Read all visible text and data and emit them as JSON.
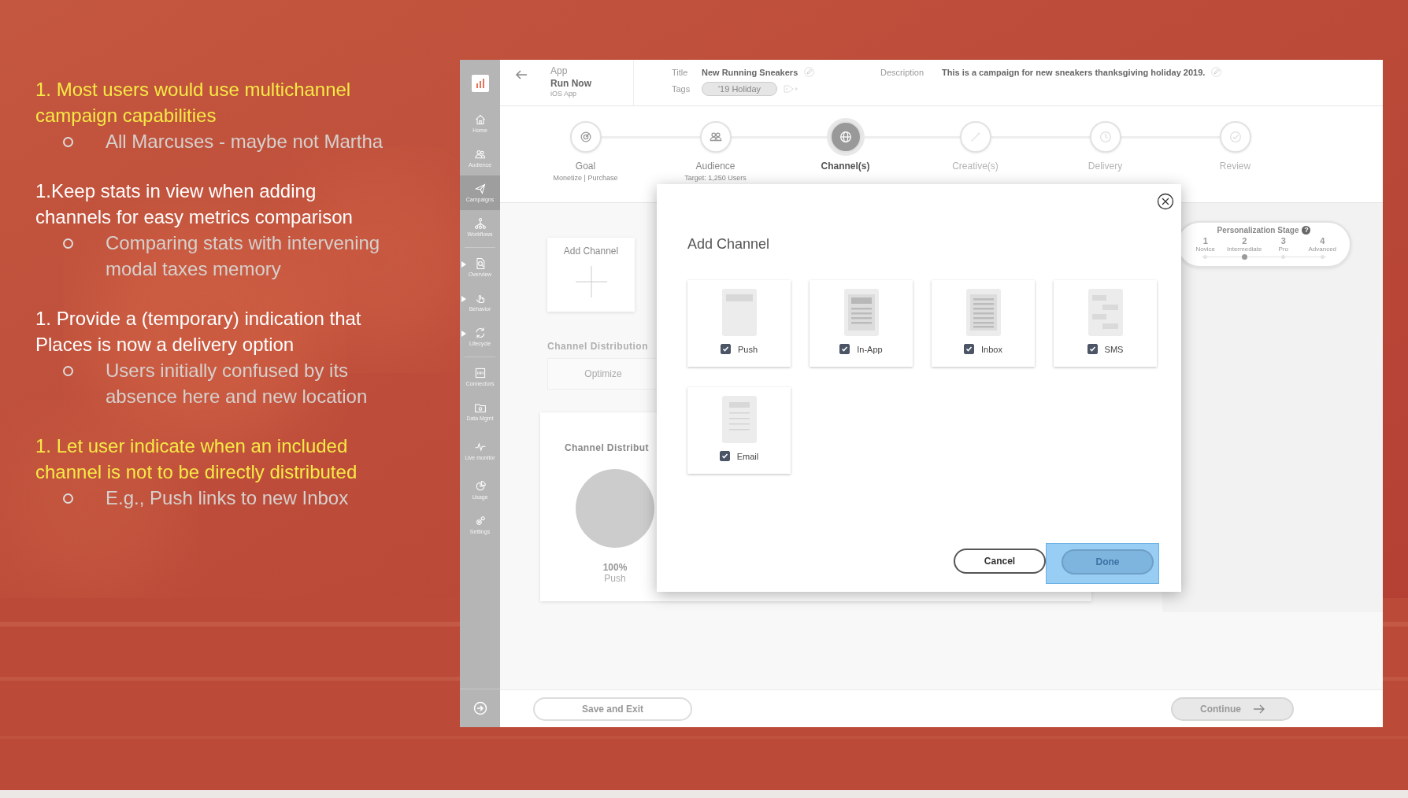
{
  "notes": [
    {
      "heading": "1. Most users would use multichannel campaign capabilities",
      "highlighted": true,
      "subpoints": [
        "All Marcuses - maybe not Martha"
      ]
    },
    {
      "heading": "1.Keep stats in view when adding channels for easy metrics comparison",
      "highlighted": false,
      "subpoints": [
        "Comparing stats with intervening modal taxes memory"
      ]
    },
    {
      "heading": "1. Provide a (temporary) indication that Places is now a delivery option",
      "highlighted": false,
      "subpoints": [
        "Users initially confused by its absence here and new location"
      ]
    },
    {
      "heading": "1. Let user indicate when an included channel is not to be directly distributed",
      "highlighted": true,
      "subpoints": [
        "E.g., Push links to new Inbox"
      ]
    }
  ],
  "app": {
    "sidebar": {
      "groups": [
        [
          {
            "label": "Home",
            "selected": false,
            "expandable": false
          },
          {
            "label": "Audience",
            "selected": false,
            "expandable": false
          },
          {
            "label": "Campaigns",
            "selected": true,
            "expandable": false
          },
          {
            "label": "Workflows",
            "selected": false,
            "expandable": false
          }
        ],
        [
          {
            "label": "Overview",
            "selected": false,
            "expandable": true
          },
          {
            "label": "Behavior",
            "selected": false,
            "expandable": true
          },
          {
            "label": "Lifecycle",
            "selected": false,
            "expandable": true
          }
        ],
        [
          {
            "label": "Connectors",
            "selected": false,
            "expandable": false
          },
          {
            "label": "Data Mgmt",
            "selected": false,
            "expandable": false
          },
          {
            "label": "Live monitor",
            "selected": false,
            "expandable": false
          },
          {
            "label": "Usage",
            "selected": false,
            "expandable": false
          },
          {
            "label": "Settings",
            "selected": false,
            "expandable": false
          }
        ]
      ]
    },
    "header": {
      "app_label": "App",
      "app_name": "Run Now",
      "platform": "iOS App",
      "title_label": "Title",
      "title": "New Running Sneakers",
      "tags_label": "Tags",
      "tags": [
        "'19 Holiday"
      ],
      "description_label": "Description",
      "description": "This is a campaign for new sneakers thanksgiving holiday 2019."
    },
    "steps": [
      {
        "label": "Goal",
        "detail": "Monetize | Purchase",
        "completed": true,
        "selected": false
      },
      {
        "label": "Audience",
        "detail": "Target: 1,250 Users",
        "completed": true,
        "selected": false
      },
      {
        "label": "Channel(s)",
        "selected": true
      },
      {
        "label": "Creative(s)",
        "completed": false,
        "selected": false
      },
      {
        "label": "Delivery",
        "completed": false,
        "selected": false
      },
      {
        "label": "Review",
        "completed": false,
        "selected": false
      }
    ],
    "content": {
      "add_channel": "Add Channel",
      "distribution_label": "Channel Distribution",
      "optimize_button": {
        "label": "Optimize",
        "disabled": true
      },
      "distribution_card": {
        "chart_data": {
          "type": "pie",
          "title": "Channel Distribut",
          "categories": [
            "Push"
          ],
          "values": [
            100
          ],
          "value_labels": [
            "100%"
          ]
        }
      }
    },
    "personalization": {
      "title": "Personalization Stage",
      "help_icon": "?",
      "stages": [
        {
          "number": "1",
          "label": "Novice",
          "selected": false
        },
        {
          "number": "2",
          "label": "Intermediate",
          "selected": true
        },
        {
          "number": "3",
          "label": "Pro",
          "selected": false
        },
        {
          "number": "4",
          "label": "Advanced",
          "selected": false
        }
      ]
    },
    "modal": {
      "title": "Add Channel",
      "channels": [
        {
          "label": "Push",
          "kind": "push",
          "checked": true
        },
        {
          "label": "In-App",
          "kind": "inapp",
          "checked": true
        },
        {
          "label": "Inbox",
          "kind": "inbox",
          "checked": true
        },
        {
          "label": "SMS",
          "kind": "sms",
          "checked": true
        },
        {
          "label": "Email",
          "kind": "email",
          "checked": true
        }
      ],
      "cancel_button": "Cancel",
      "done_button": "Done",
      "done_highlighted": true
    },
    "footer": {
      "save_button": "Save and Exit",
      "continue_button": "Continue"
    }
  }
}
